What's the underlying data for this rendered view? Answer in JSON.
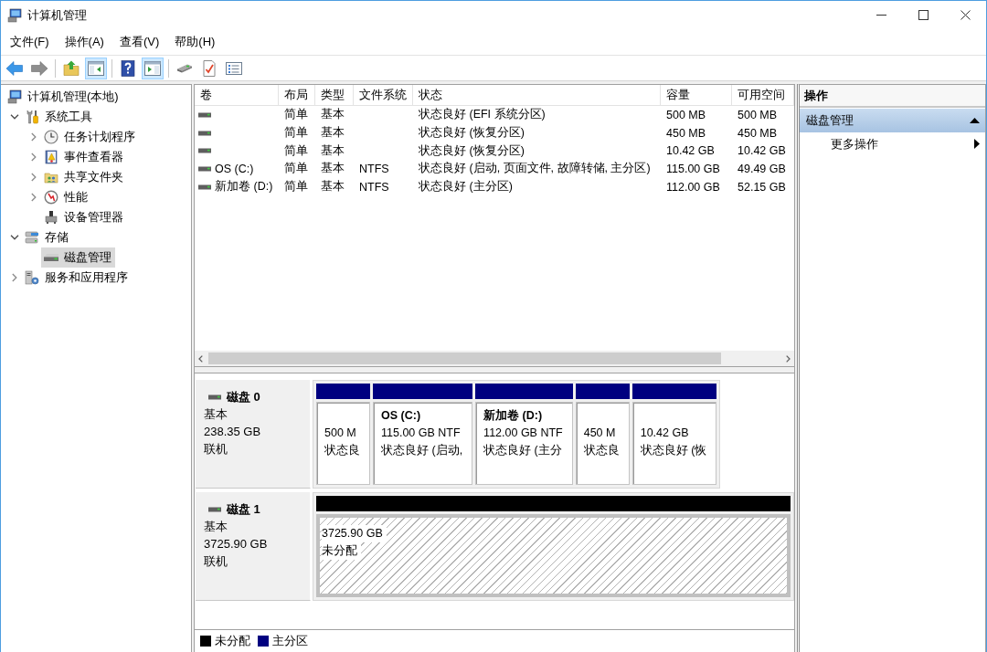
{
  "window": {
    "title": "计算机管理"
  },
  "menu": [
    "文件(F)",
    "操作(A)",
    "查看(V)",
    "帮助(H)"
  ],
  "toolbar": [
    [
      {
        "kind": "back",
        "pressed": false,
        "disabled": false
      },
      {
        "kind": "forward",
        "pressed": false,
        "disabled": true
      }
    ],
    [
      {
        "kind": "up",
        "pressed": false,
        "disabled": false
      },
      {
        "kind": "console_tree",
        "pressed": true,
        "disabled": false
      }
    ],
    [
      {
        "kind": "help",
        "pressed": false,
        "disabled": false
      },
      {
        "kind": "action_pane",
        "pressed": true,
        "disabled": false
      }
    ],
    [
      {
        "kind": "connect",
        "pressed": false,
        "disabled": false
      },
      {
        "kind": "properties",
        "pressed": false,
        "disabled": false
      },
      {
        "kind": "list",
        "pressed": false,
        "disabled": false
      }
    ]
  ],
  "tree": [
    {
      "label": "计算机管理(本地)",
      "selected": false,
      "children": [
        {
          "label": "系统工具",
          "expanded": true,
          "selected": false,
          "children": [
            {
              "label": "任务计划程序",
              "expanded": false,
              "selected": false
            },
            {
              "label": "事件查看器",
              "expanded": false,
              "selected": false
            },
            {
              "label": "共享文件夹",
              "expanded": false,
              "selected": false
            },
            {
              "label": "性能",
              "expanded": false,
              "selected": false
            },
            {
              "label": "设备管理器",
              "selected": false
            }
          ]
        },
        {
          "label": "存储",
          "expanded": true,
          "selected": false,
          "children": [
            {
              "label": "磁盘管理",
              "selected": true
            }
          ]
        },
        {
          "label": "服务和应用程序",
          "expanded": false,
          "selected": false
        }
      ]
    }
  ],
  "volume_table": {
    "columns": [
      "卷",
      "布局",
      "类型",
      "文件系统",
      "状态",
      "容量",
      "可用空间"
    ],
    "rows": [
      {
        "layout": "简单",
        "type": "基本",
        "status": "状态良好 (EFI 系统分区)",
        "capacity": "500 MB",
        "free": "500 MB"
      },
      {
        "layout": "简单",
        "type": "基本",
        "status": "状态良好 (恢复分区)",
        "capacity": "450 MB",
        "free": "450 MB"
      },
      {
        "layout": "简单",
        "type": "基本",
        "status": "状态良好 (恢复分区)",
        "capacity": "10.42 GB",
        "free": "10.42 GB"
      },
      {
        "volume": "OS (C:)",
        "layout": "简单",
        "type": "基本",
        "file_system": "NTFS",
        "status": "状态良好 (启动, 页面文件, 故障转储, 主分区)",
        "capacity": "115.00 GB",
        "free": "49.49 GB"
      },
      {
        "volume": "新加卷 (D:)",
        "layout": "简单",
        "type": "基本",
        "file_system": "NTFS",
        "status": "状态良好 (主分区)",
        "capacity": "112.00 GB",
        "free": "52.15 GB"
      }
    ]
  },
  "disks": [
    {
      "name": "磁盘 0",
      "type": "基本",
      "size": "238.35 GB",
      "status": "联机",
      "partitions": [
        {
          "kind": "primary",
          "size": "500 M",
          "status": "状态良"
        },
        {
          "kind": "primary",
          "title": "OS  (C:)",
          "size": "115.00 GB NTF",
          "status": "状态良好 (启动,"
        },
        {
          "kind": "primary",
          "title": "新加卷  (D:)",
          "size": "112.00 GB NTF",
          "status": "状态良好 (主分"
        },
        {
          "kind": "primary",
          "size": "450 M",
          "status": "状态良"
        },
        {
          "kind": "primary",
          "size": "10.42 GB",
          "status": "状态良好 (恢"
        }
      ]
    },
    {
      "name": "磁盘 1",
      "type": "基本",
      "size": "3725.90 GB",
      "status": "联机",
      "partitions": [
        {
          "kind": "unallocated",
          "size": "3725.90 GB",
          "status": "未分配"
        }
      ]
    }
  ],
  "legend": [
    {
      "label": "未分配",
      "color": "#000000"
    },
    {
      "label": "主分区",
      "color": "#000080"
    }
  ],
  "actions": {
    "title": "操作",
    "groups": [
      {
        "label": "磁盘管理",
        "expanded": true,
        "items": [
          {
            "label": "更多操作",
            "submenu": true
          }
        ]
      }
    ]
  }
}
